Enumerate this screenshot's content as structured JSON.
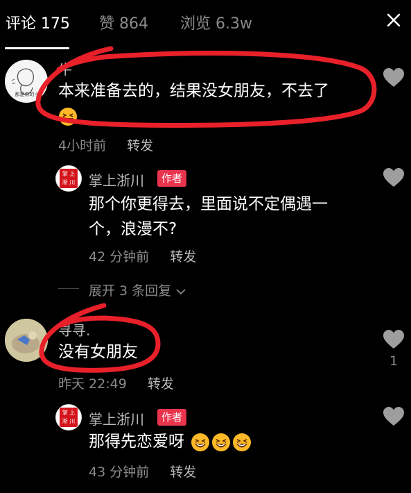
{
  "tabs": [
    {
      "label": "评论 175"
    },
    {
      "label": "赞 864"
    },
    {
      "label": "浏览 6.3w"
    }
  ],
  "comments": [
    {
      "username": "牛",
      "text": "本来准备去的，结果没女朋友，不去了",
      "time": "4小时前",
      "reply_label": "转发",
      "avatar_caption": "那是你的小",
      "reply": {
        "username": "掌上浙川",
        "badge": "作者",
        "text_line1": "那个你更得去，里面说不定偶遇一",
        "text_line2": "个，浪漫不?",
        "time": "42 分钟前",
        "reply_label": "转发",
        "avatar_text_top": "掌 上",
        "avatar_text_bottom": "淅 川"
      },
      "expand_label": "展开 3 条回复"
    },
    {
      "username": "寻寻.",
      "text": "没有女朋友",
      "time": "昨天 22:49",
      "reply_label": "转发",
      "like_count": "1",
      "reply": {
        "username": "掌上浙川",
        "badge": "作者",
        "text": "那得先恋爱呀",
        "time": "43 分钟前",
        "reply_label": "转发",
        "avatar_text_top": "掌 上",
        "avatar_text_bottom": "淅 川"
      }
    }
  ],
  "colors": {
    "background": "#000000",
    "badge": "#e8344d",
    "annotation_red": "#e8202a",
    "muted_text": "#8a8a8a",
    "heart": "#9e9e9e"
  },
  "icons": {
    "close": "close-icon",
    "like": "heart-icon",
    "emoji": "grinning-squint-emoji",
    "expand": "chevron-down-icon"
  }
}
